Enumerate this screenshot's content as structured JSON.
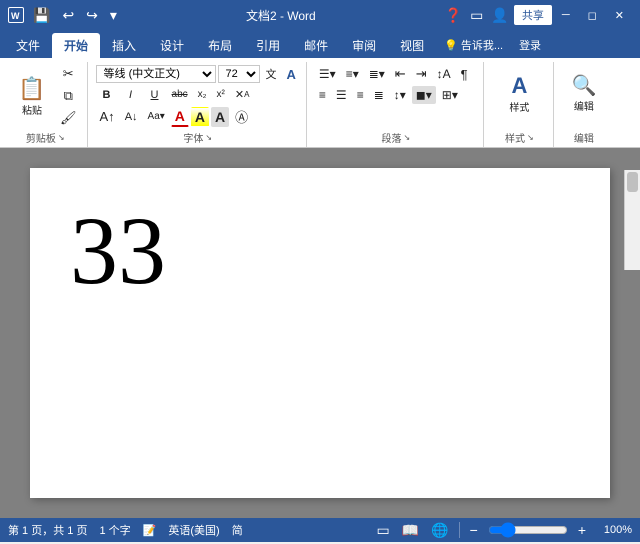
{
  "titlebar": {
    "title": "文档2 - Word",
    "quickaccess": [
      "save",
      "undo",
      "redo",
      "customize"
    ],
    "tabs_right": [
      "help",
      "minimize",
      "restore",
      "close"
    ],
    "share_label": "共享"
  },
  "ribbon": {
    "tabs": [
      "文件",
      "开始",
      "插入",
      "设计",
      "布局",
      "引用",
      "邮件",
      "审阅",
      "视图"
    ],
    "active_tab": "开始",
    "groups": {
      "clipboard": {
        "label": "剪贴板",
        "paste_label": "粘贴",
        "cut_label": "剪切",
        "copy_label": "复制",
        "format_label": "格式刷"
      },
      "font": {
        "label": "字体",
        "font_name": "等线 (中文正文)",
        "font_size": "72",
        "bold": "B",
        "italic": "I",
        "underline": "U",
        "strikethrough": "abc",
        "subscript": "x₂",
        "superscript": "x²",
        "clear": "清",
        "font_color": "A",
        "highlight": "A",
        "size_up": "A↑",
        "size_down": "A↓",
        "change_case": "Aa"
      },
      "paragraph": {
        "label": "段落",
        "expand_label": "↘"
      },
      "styles": {
        "label": "样式",
        "expand_label": "↘"
      },
      "editing": {
        "label": "编辑",
        "search_label": "编辑"
      }
    }
  },
  "document": {
    "content": "33",
    "cursor_visible": true
  },
  "statusbar": {
    "page_info": "第 1 页，共 1 页",
    "word_count": "1 个字",
    "language": "英语(美国)",
    "track_changes": "简",
    "zoom_level": "100%",
    "zoom_value": 100
  }
}
